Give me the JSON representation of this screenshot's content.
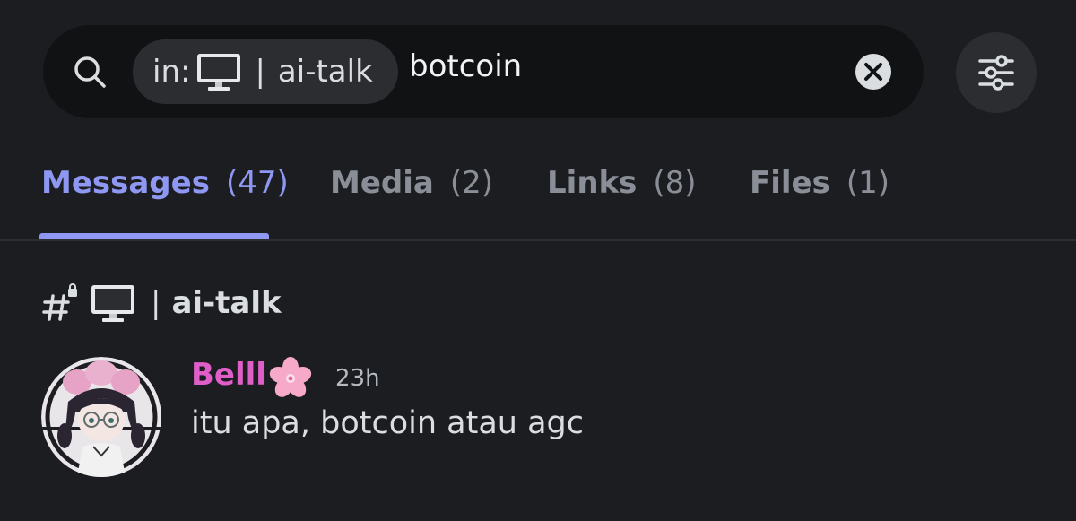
{
  "search": {
    "filter_prefix": "in:",
    "filter_channel_separator": "|",
    "filter_channel_name": "ai-talk",
    "query": "botcoin",
    "icons": {
      "search": "search-icon",
      "clear": "close-circle-icon",
      "filters": "sliders-icon",
      "channel_emoji": "monitor-icon"
    }
  },
  "tabs": [
    {
      "label": "Messages",
      "count": "(47)",
      "active": true
    },
    {
      "label": "Media",
      "count": "(2)",
      "active": false
    },
    {
      "label": "Links",
      "count": "(8)",
      "active": false
    },
    {
      "label": "Files",
      "count": "(1)",
      "active": false
    }
  ],
  "channel_header": {
    "icon": "locked-hash-icon",
    "emoji": "monitor-icon",
    "separator": "|",
    "name": "ai-talk"
  },
  "message": {
    "author": "Belll",
    "author_emoji": "cherry-blossom-icon",
    "timestamp": "23h",
    "text": "itu apa, botcoin atau agc"
  },
  "colors": {
    "background": "#1c1d21",
    "search_bar": "#111214",
    "chip": "#2b2d31",
    "accent": "#8e98f2",
    "tab_inactive": "#8a8e96",
    "author": "#e05ec8",
    "text": "#dbdee1"
  }
}
